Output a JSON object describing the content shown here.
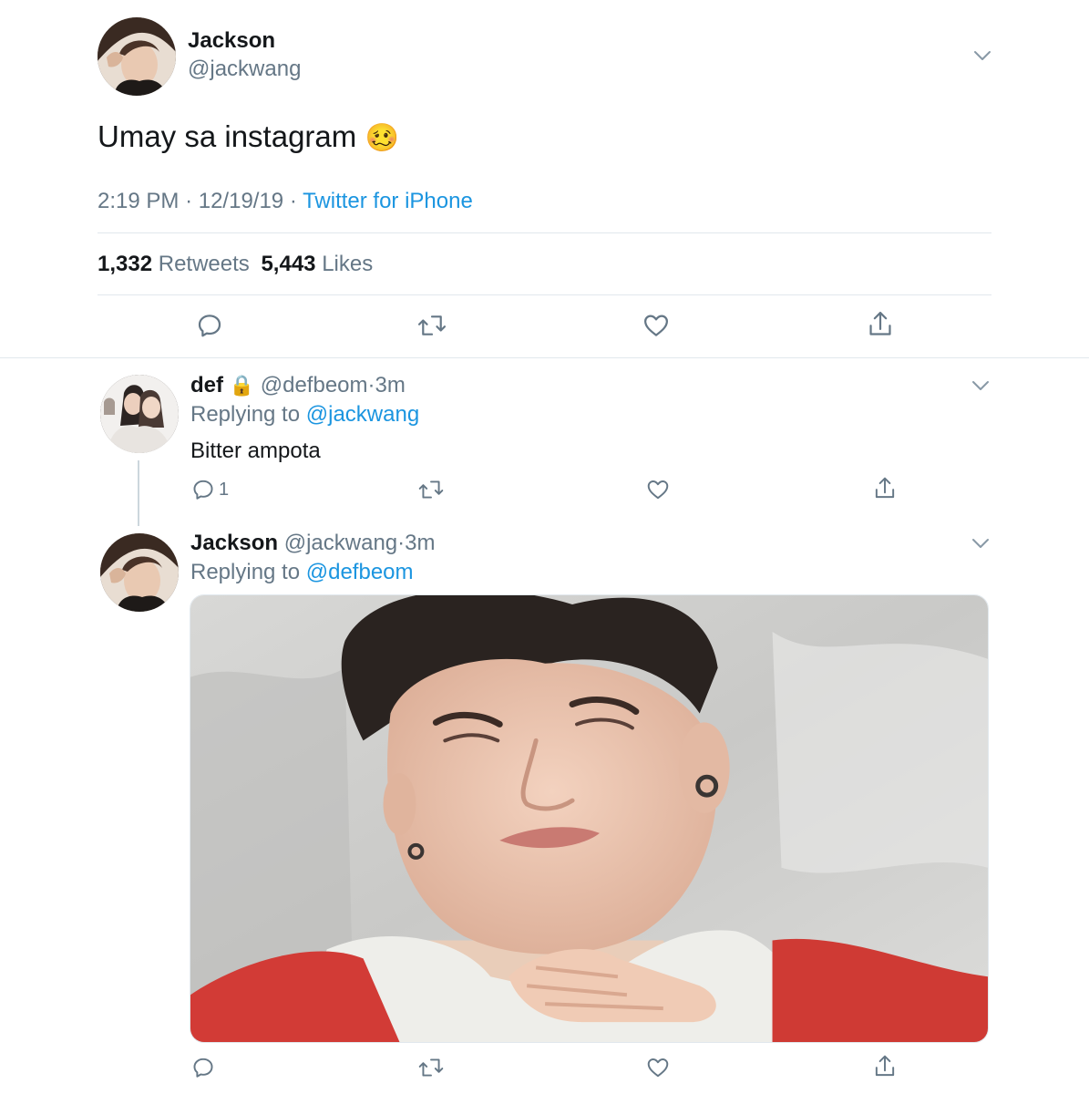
{
  "main_tweet": {
    "display_name": "Jackson",
    "handle": "@jackwang",
    "text": "Umay sa instagram",
    "emoji": "🥴",
    "time": "2:19 PM",
    "date": "12/19/19",
    "separator": "·",
    "source": "Twitter for iPhone",
    "retweets_count": "1,332",
    "retweets_label": "Retweets",
    "likes_count": "5,443",
    "likes_label": "Likes"
  },
  "reply_1": {
    "display_name": "def",
    "lock_emoji": "🔒",
    "handle": "@defbeom",
    "separator": "·",
    "age": "3m",
    "replying_label": "Replying to",
    "replying_to": "@jackwang",
    "text": "Bitter ampota",
    "reply_count": "1"
  },
  "reply_2": {
    "display_name": "Jackson",
    "handle": "@jackwang",
    "separator": "·",
    "age": "3m",
    "replying_label": "Replying to",
    "replying_to": "@defbeom"
  },
  "icons": {
    "reply": "reply-icon",
    "retweet": "retweet-icon",
    "like": "heart-icon",
    "share": "share-icon",
    "more": "chevron-down-icon",
    "lock": "lock-icon"
  },
  "colors": {
    "link": "#1b95e0",
    "muted": "#657786",
    "text": "#14171a",
    "divider": "#e1e8ed"
  }
}
